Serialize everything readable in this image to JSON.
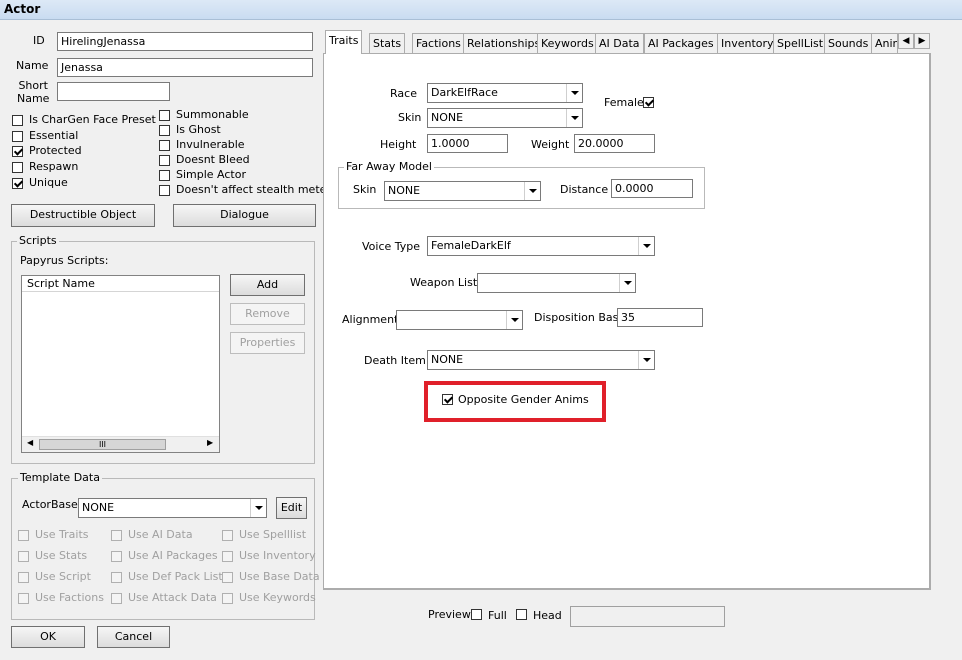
{
  "window": {
    "title": "Actor"
  },
  "left": {
    "id_label": "ID",
    "id_value": "HirelingJenassa",
    "name_label": "Name",
    "name_value": "Jenassa",
    "short_name_label": "Short\nName",
    "short_name_value": "",
    "flags_left": [
      {
        "label": "Is CharGen Face Preset",
        "checked": false
      },
      {
        "label": "Essential",
        "checked": false
      },
      {
        "label": "Protected",
        "checked": true
      },
      {
        "label": "Respawn",
        "checked": false
      },
      {
        "label": "Unique",
        "checked": true
      }
    ],
    "flags_right": [
      {
        "label": "Summonable",
        "checked": false
      },
      {
        "label": "Is Ghost",
        "checked": false
      },
      {
        "label": "Invulnerable",
        "checked": false
      },
      {
        "label": "Doesnt Bleed",
        "checked": false
      },
      {
        "label": "Simple Actor",
        "checked": false
      },
      {
        "label": "Doesn't affect stealth meter",
        "checked": false
      }
    ],
    "destructible_button": "Destructible Object",
    "dialogue_button": "Dialogue",
    "scripts": {
      "group_label": "Scripts",
      "papyrus_label": "Papyrus Scripts:",
      "column_header": "Script Name",
      "add": "Add",
      "remove": "Remove",
      "properties": "Properties",
      "scroll_grip": "III"
    },
    "template": {
      "group_label": "Template Data",
      "actorbase_label": "ActorBase",
      "actorbase_value": "NONE",
      "edit_button": "Edit",
      "options": [
        "Use Traits",
        "Use AI Data",
        "Use Spelllist",
        "Use Stats",
        "Use AI Packages",
        "Use Inventory",
        "Use Script",
        "Use Def Pack List",
        "Use Base Data",
        "Use Factions",
        "Use Attack Data",
        "Use Keywords"
      ]
    },
    "ok_button": "OK",
    "cancel_button": "Cancel"
  },
  "tabs": [
    "Traits",
    "Stats",
    "Factions",
    "Relationships",
    "Keywords",
    "AI Data",
    "AI Packages",
    "Inventory",
    "SpellList",
    "Sounds",
    "Anim"
  ],
  "traits": {
    "race_label": "Race",
    "race_value": "DarkElfRace",
    "female_label": "Female",
    "female_checked": true,
    "skin_label": "Skin",
    "skin_value": "NONE",
    "height_label": "Height",
    "height_value": "1.0000",
    "weight_label": "Weight",
    "weight_value": "20.0000",
    "far_away": {
      "group_label": "Far Away Model",
      "skin_label": "Skin",
      "skin_value": "NONE",
      "distance_label": "Distance",
      "distance_value": "0.0000"
    },
    "voice_label": "Voice Type",
    "voice_value": "FemaleDarkElf",
    "weapon_list_label": "Weapon List",
    "weapon_list_value": "",
    "alignment_label": "Alignment",
    "alignment_value": "",
    "disposition_label": "Disposition Base",
    "disposition_value": "35",
    "death_item_label": "Death Item",
    "death_item_value": "NONE",
    "opposite_gender_label": "Opposite Gender Anims",
    "opposite_gender_checked": true,
    "highlight_color": "#e0202a"
  },
  "preview": {
    "label": "Preview",
    "full_label": "Full",
    "head_label": "Head"
  }
}
